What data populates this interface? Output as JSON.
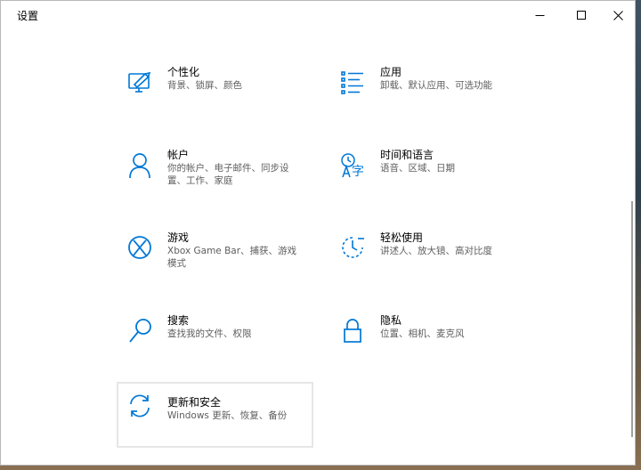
{
  "window": {
    "title": "设置"
  },
  "colors": {
    "accent": "#0078d7"
  },
  "categories": [
    {
      "name": "个性化",
      "desc": "背景、锁屏、颜色",
      "icon": "personalization-icon"
    },
    {
      "name": "应用",
      "desc": "卸载、默认应用、可选功能",
      "icon": "apps-icon"
    },
    {
      "name": "帐户",
      "desc": "你的帐户、电子邮件、同步设置、工作、家庭",
      "icon": "accounts-icon"
    },
    {
      "name": "时间和语言",
      "desc": "语音、区域、日期",
      "icon": "time-language-icon"
    },
    {
      "name": "游戏",
      "desc": "Xbox Game Bar、捕获、游戏模式",
      "icon": "xbox-icon"
    },
    {
      "name": "轻松使用",
      "desc": "讲述人、放大镜、高对比度",
      "icon": "ease-of-access-icon"
    },
    {
      "name": "搜索",
      "desc": "查找我的文件、权限",
      "icon": "search-icon"
    },
    {
      "name": "隐私",
      "desc": "位置、相机、麦克风",
      "icon": "lock-icon"
    },
    {
      "name": "更新和安全",
      "desc": "Windows 更新、恢复、备份",
      "icon": "update-icon"
    }
  ]
}
